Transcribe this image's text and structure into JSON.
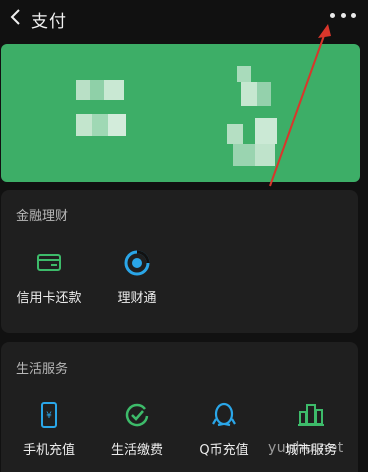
{
  "header": {
    "title": "支付",
    "back_icon": "chevron-left-icon",
    "more_icon": "more-dots-icon"
  },
  "wallet_card": {
    "background_color": "#3dae67",
    "note": ""
  },
  "finance": {
    "section_title": "金融理财",
    "items": [
      {
        "label": "信用卡还款",
        "icon": "credit-card-icon",
        "color": "#3dbb6a"
      },
      {
        "label": "理财通",
        "icon": "licaitong-icon",
        "color": "#2aa6e8"
      }
    ]
  },
  "life": {
    "section_title": "生活服务",
    "items": [
      {
        "label": "手机充值",
        "icon": "phone-recharge-icon",
        "color": "#2aa6e8"
      },
      {
        "label": "生活缴费",
        "icon": "bill-payment-icon",
        "color": "#3dbb6a"
      },
      {
        "label": "Q币充值",
        "icon": "penguin-icon",
        "color": "#2aa6e8"
      },
      {
        "label": "城市服务",
        "icon": "city-services-icon",
        "color": "#3dbb6a"
      }
    ]
  },
  "overlay": {
    "watermark": "yunhu.net",
    "arrow_color": "#d9362b"
  }
}
